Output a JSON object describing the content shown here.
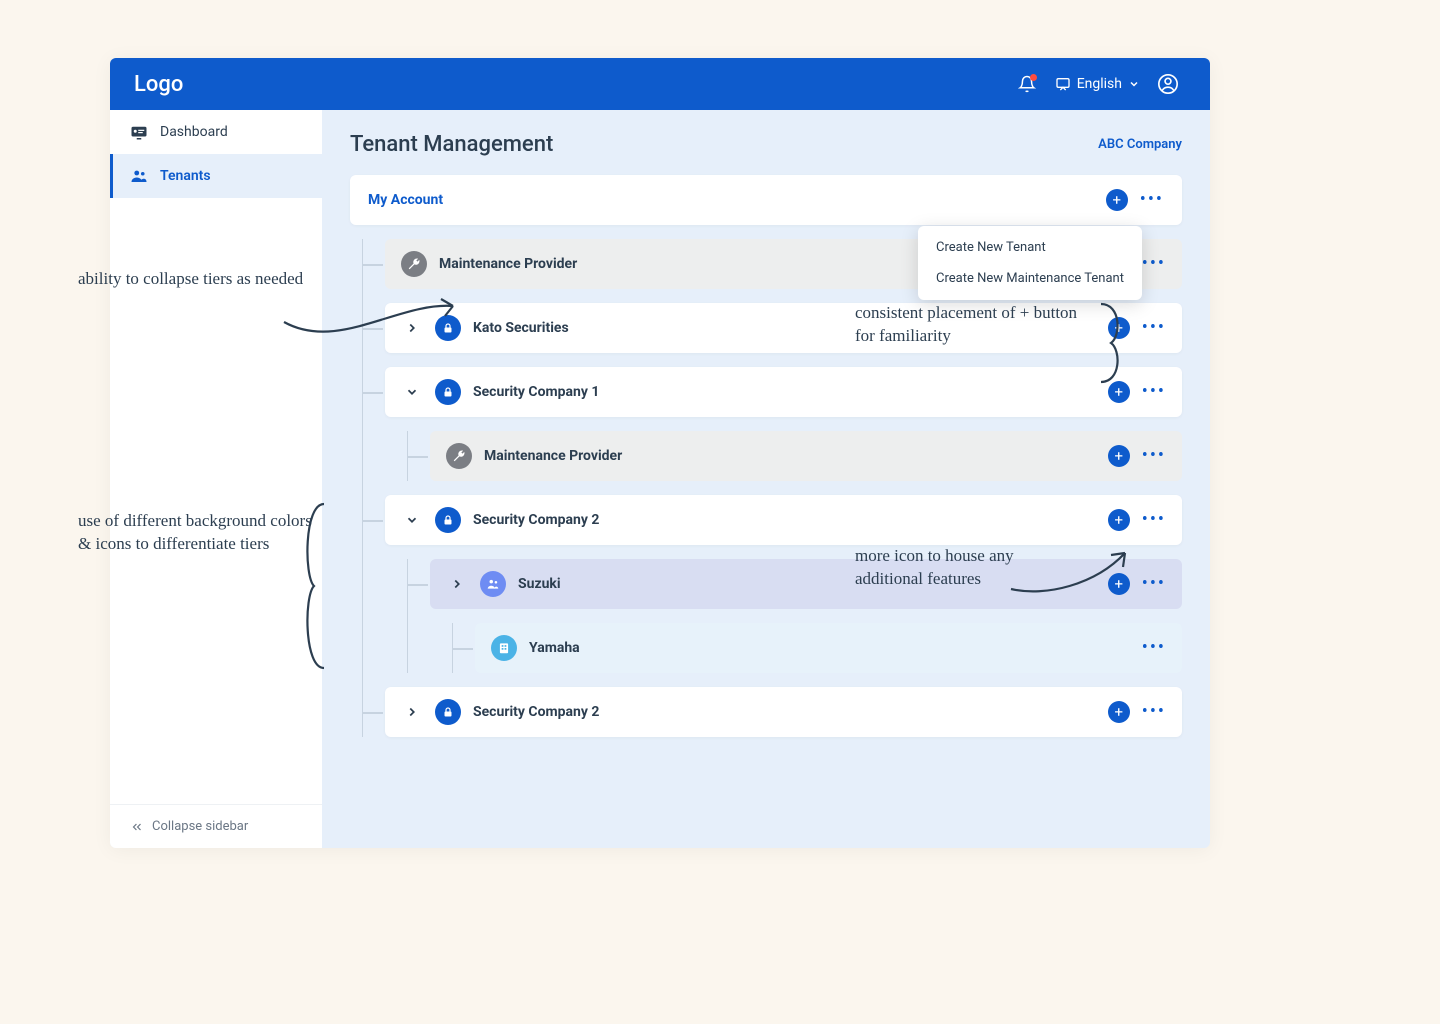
{
  "header": {
    "logo": "Logo",
    "language_label": "English"
  },
  "sidebar": {
    "items": [
      {
        "label": "Dashboard"
      },
      {
        "label": "Tenants"
      }
    ],
    "collapse_label": "Collapse sidebar"
  },
  "page": {
    "title": "Tenant Management",
    "company_link": "ABC Company"
  },
  "tree": {
    "root_label": "My Account",
    "dropdown": [
      "Create New Tenant",
      "Create New Maintenance Tenant"
    ],
    "nodes": {
      "maintenance_provider": "Maintenance Provider",
      "kato_securities": "Kato Securities",
      "security_company_1": "Security Company 1",
      "sc1_maintenance_provider": "Maintenance Provider",
      "security_company_2": "Security Company 2",
      "suzuki": "Suzuki",
      "yamaha": "Yamaha",
      "security_company_2b": "Security Company 2"
    }
  },
  "annotations": {
    "collapse_tiers": "ability to collapse tiers as needed",
    "bg_colors": "use of different background colors & icons to differentiate tiers",
    "plus_button": "consistent placement of + button for familiarity",
    "more_icon": "more icon to house any additional features"
  }
}
